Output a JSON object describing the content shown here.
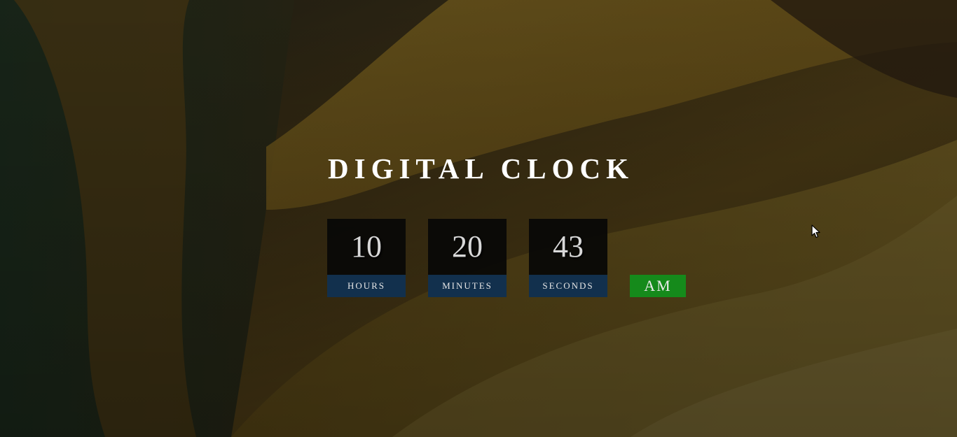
{
  "page": {
    "title": "DIGITAL CLOCK"
  },
  "clock": {
    "hours": {
      "value": "10",
      "label": "HOURS"
    },
    "minutes": {
      "value": "20",
      "label": "MINUTES"
    },
    "seconds": {
      "value": "43",
      "label": "SECONDS"
    },
    "period": "AM"
  },
  "colors": {
    "digit_box": "#080806",
    "label_box": "#12304d",
    "period_badge": "#158a1b",
    "title_text": "#ffffff"
  },
  "icons": {
    "cursor": "mouse-pointer-icon"
  }
}
